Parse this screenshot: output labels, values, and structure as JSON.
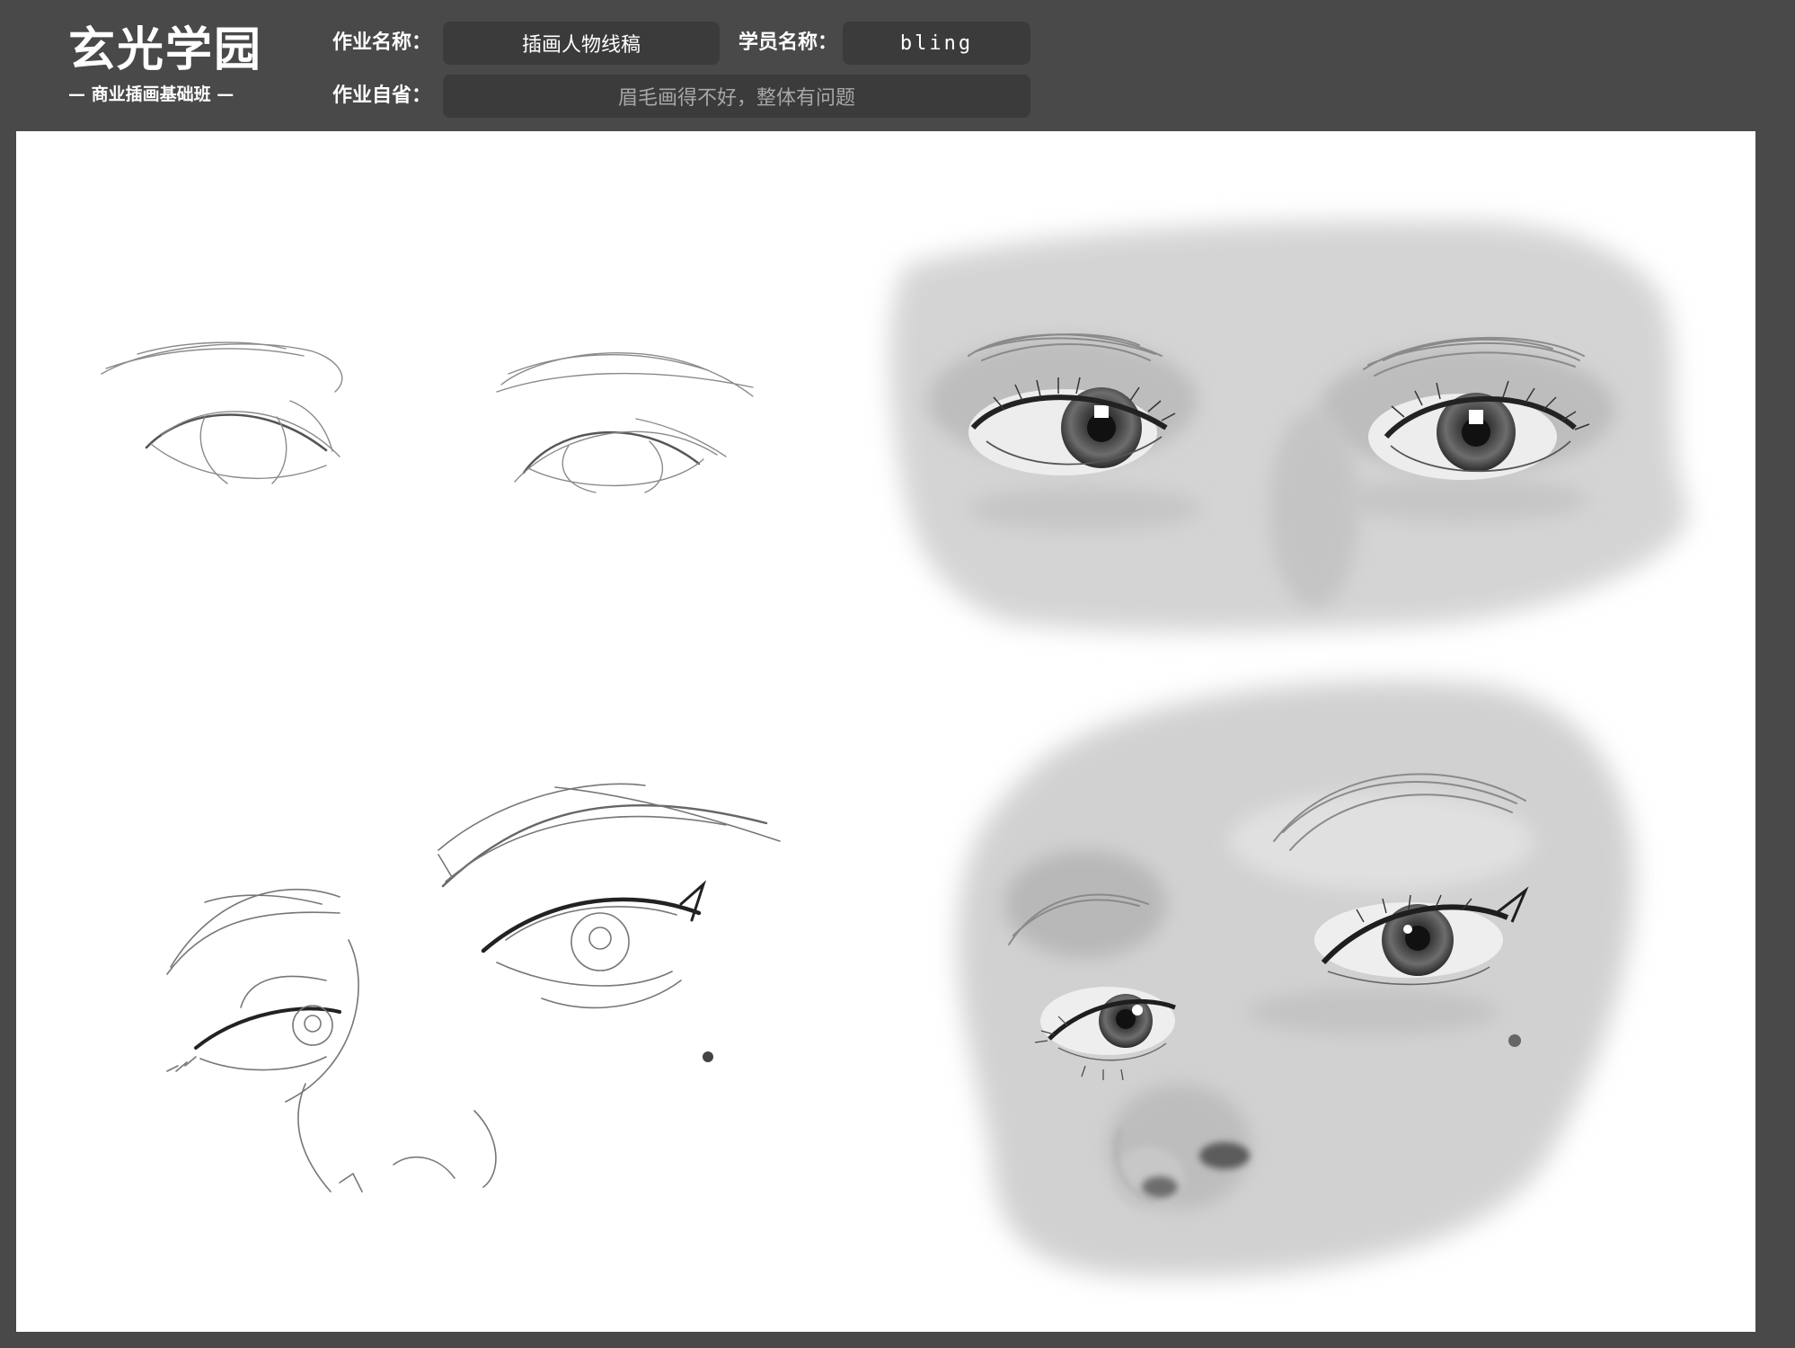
{
  "logo": {
    "title": "玄光学园",
    "subtitle": "— 商业插画基础班 —"
  },
  "form": {
    "homework_name_label": "作业名称：",
    "homework_name_value": "插画人物线稿",
    "student_name_label": "学员名称：",
    "student_name_value": "bling",
    "self_review_label": "作业自省：",
    "self_review_value": "眉毛画得不好，整体有问题"
  },
  "colors": {
    "background": "#4a4949",
    "field_box": "#3c3b3b",
    "canvas": "#ffffff"
  }
}
